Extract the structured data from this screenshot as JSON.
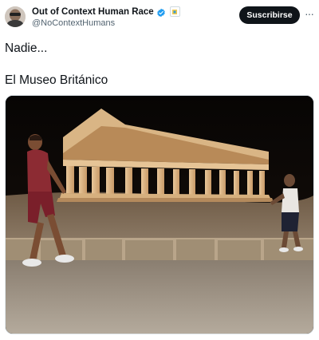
{
  "account": {
    "display_name": "Out of Context Human Race",
    "handle": "@NoContextHumans",
    "verified_icon": "verified-badge-icon",
    "affiliate_icon": "affiliate-badge-icon"
  },
  "actions": {
    "subscribe_label": "Suscribirse",
    "more_label": "···"
  },
  "tweet": {
    "line1": "Nadie...",
    "line2": "El Museo Británico"
  },
  "media": {
    "description_icon": "photo-temple-night"
  },
  "colors": {
    "text": "#0f1419",
    "secondary": "#536471",
    "verified_blue": "#1d9bf0",
    "button_bg": "#0f1419"
  }
}
